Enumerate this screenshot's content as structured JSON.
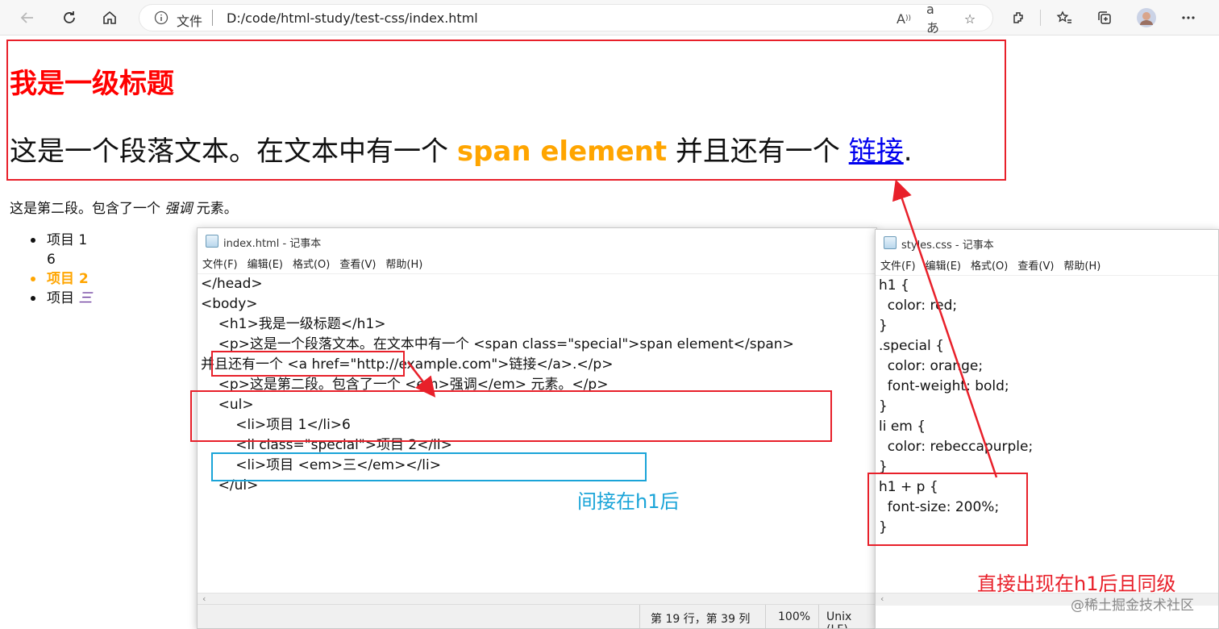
{
  "browser": {
    "address_prefix": "文件",
    "url": "D:/code/html-study/test-css/index.html"
  },
  "page": {
    "h1": "我是一级标题",
    "p1_before": "这是一个段落文本。在文本中有一个 ",
    "p1_span": "span element",
    "p1_middle": " 并且还有一个 ",
    "p1_link": "链接",
    "p1_end": ".",
    "p2_before": "这是第二段。包含了一个 ",
    "p2_em": "强调",
    "p2_after": " 元素。",
    "list": {
      "item1": "项目 1",
      "item1_extra": "6",
      "item2": "项目 2",
      "item3_prefix": "项目 ",
      "item3_em": "三"
    }
  },
  "notepad_html": {
    "title": "index.html - 记事本",
    "menu": [
      "文件(F)",
      "编辑(E)",
      "格式(O)",
      "查看(V)",
      "帮助(H)"
    ],
    "lines": [
      "</head>",
      "",
      "<body>",
      "",
      "    <h1>我是一级标题</h1>",
      "",
      "    <p>这是一个段落文本。在文本中有一个 <span class=\"special\">span element</span>",
      "并且还有一个 <a href=\"http://example.com\">链接</a>.</p>",
      "",
      "    <p>这是第二段。包含了一个 <em>强调</em> 元素。</p>",
      "",
      "    <ul>",
      "        <li>项目 1</li>6",
      "        <li class=\"special\">项目 2</li>",
      "        <li>项目 <em>三</em></li>",
      "    </ul>"
    ],
    "status": {
      "position": "第 19 行，第 39 列",
      "zoom": "100%",
      "line_ending": "Unix (LF)"
    }
  },
  "notepad_css": {
    "title": "styles.css - 记事本",
    "menu": [
      "文件(F)",
      "编辑(E)",
      "格式(O)",
      "查看(V)",
      "帮助(H)"
    ],
    "lines": [
      "h1 {",
      "  color: red;",
      "}",
      ".special {",
      "  color: orange;",
      "  font-weight: bold;",
      "}",
      "li em {",
      "  color: rebeccapurple;",
      "}",
      "h1 + p {",
      "  font-size: 200%;",
      "}"
    ]
  },
  "annotations": {
    "indirect": "间接在h1后",
    "direct": "直接出现在h1后且同级",
    "watermark": "@稀土掘金技术社区"
  },
  "colors": {
    "annotation_red": "#e8202a",
    "annotation_blue": "#1aa4d8"
  }
}
